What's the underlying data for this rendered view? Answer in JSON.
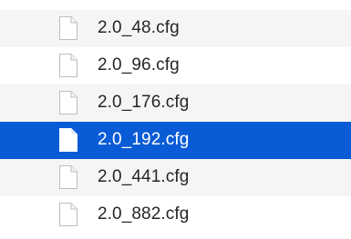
{
  "files": [
    {
      "name": "2.0_48.cfg",
      "icon": "document-icon",
      "selected": false,
      "shaded": true
    },
    {
      "name": "2.0_96.cfg",
      "icon": "document-icon",
      "selected": false,
      "shaded": false
    },
    {
      "name": "2.0_176.cfg",
      "icon": "document-icon",
      "selected": false,
      "shaded": true
    },
    {
      "name": "2.0_192.cfg",
      "icon": "document-icon",
      "selected": true,
      "shaded": false
    },
    {
      "name": "2.0_441.cfg",
      "icon": "document-icon",
      "selected": false,
      "shaded": true
    },
    {
      "name": "2.0_882.cfg",
      "icon": "document-icon",
      "selected": false,
      "shaded": false
    }
  ],
  "colors": {
    "selection": "#0a5bd6",
    "stripe": "#f5f5f5",
    "text": "#262626",
    "selected_text": "#ffffff"
  }
}
